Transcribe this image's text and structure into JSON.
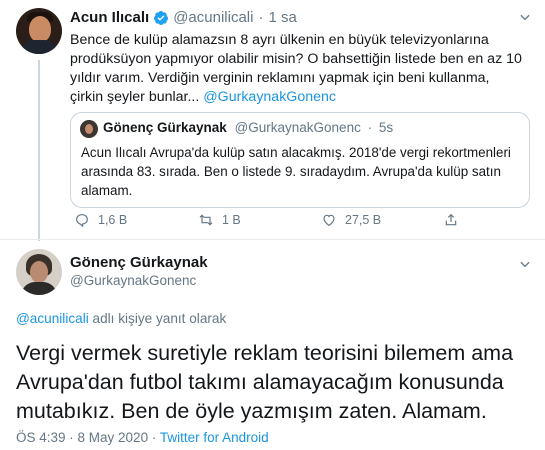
{
  "tweet1": {
    "author_name": "Acun Ilıcalı",
    "handle": "@acunilicali",
    "separator": "·",
    "time": "1 sa",
    "text": "Bence de kulüp alamazsın 8 ayrı ülkenin en büyük televizyonlarına prodüksüyon yapmıyor olabilir misin? O bahsettiğin listede ben en az 10 yıldır varım. Verdiğin verginin reklamını yapmak için beni kullanma, çirkin şeyler bunlar...",
    "mention": "@GurkaynakGonenc",
    "quoted": {
      "author_name": "Gönenç Gürkaynak",
      "handle": "@GurkaynakGonenc",
      "separator": "·",
      "time": "5s",
      "text": "Acun Ilıcalı Avrupa'da kulüp satın alacakmış. 2018'de vergi rekortmenleri arasında 83. sırada. Ben o listede 9. sıradaydım. Avrupa'da kulüp satın alamam."
    },
    "actions": {
      "replies": "1,6 B",
      "retweets": "1 B",
      "likes": "27,5 B"
    }
  },
  "tweet2": {
    "author_name": "Gönenç Gürkaynak",
    "handle": "@GurkaynakGonenc",
    "reply_mention": "@acunilicali",
    "reply_suffix": " adlı kişiye yanıt olarak",
    "text": "Vergi vermek suretiyle reklam teorisini bilemem ama Avrupa'dan futbol takımı alamayacağım konusunda mutabıkız.  Ben de öyle yazmışım zaten. Alamam.",
    "time": "ÖS 4:39",
    "separator": " · ",
    "date": "8 May 2020",
    "separator2": " · ",
    "source": "Twitter for Android"
  },
  "colors": {
    "link": "#1b95e0",
    "muted": "#657786",
    "text": "#14171a",
    "border": "#ccd6dd"
  }
}
